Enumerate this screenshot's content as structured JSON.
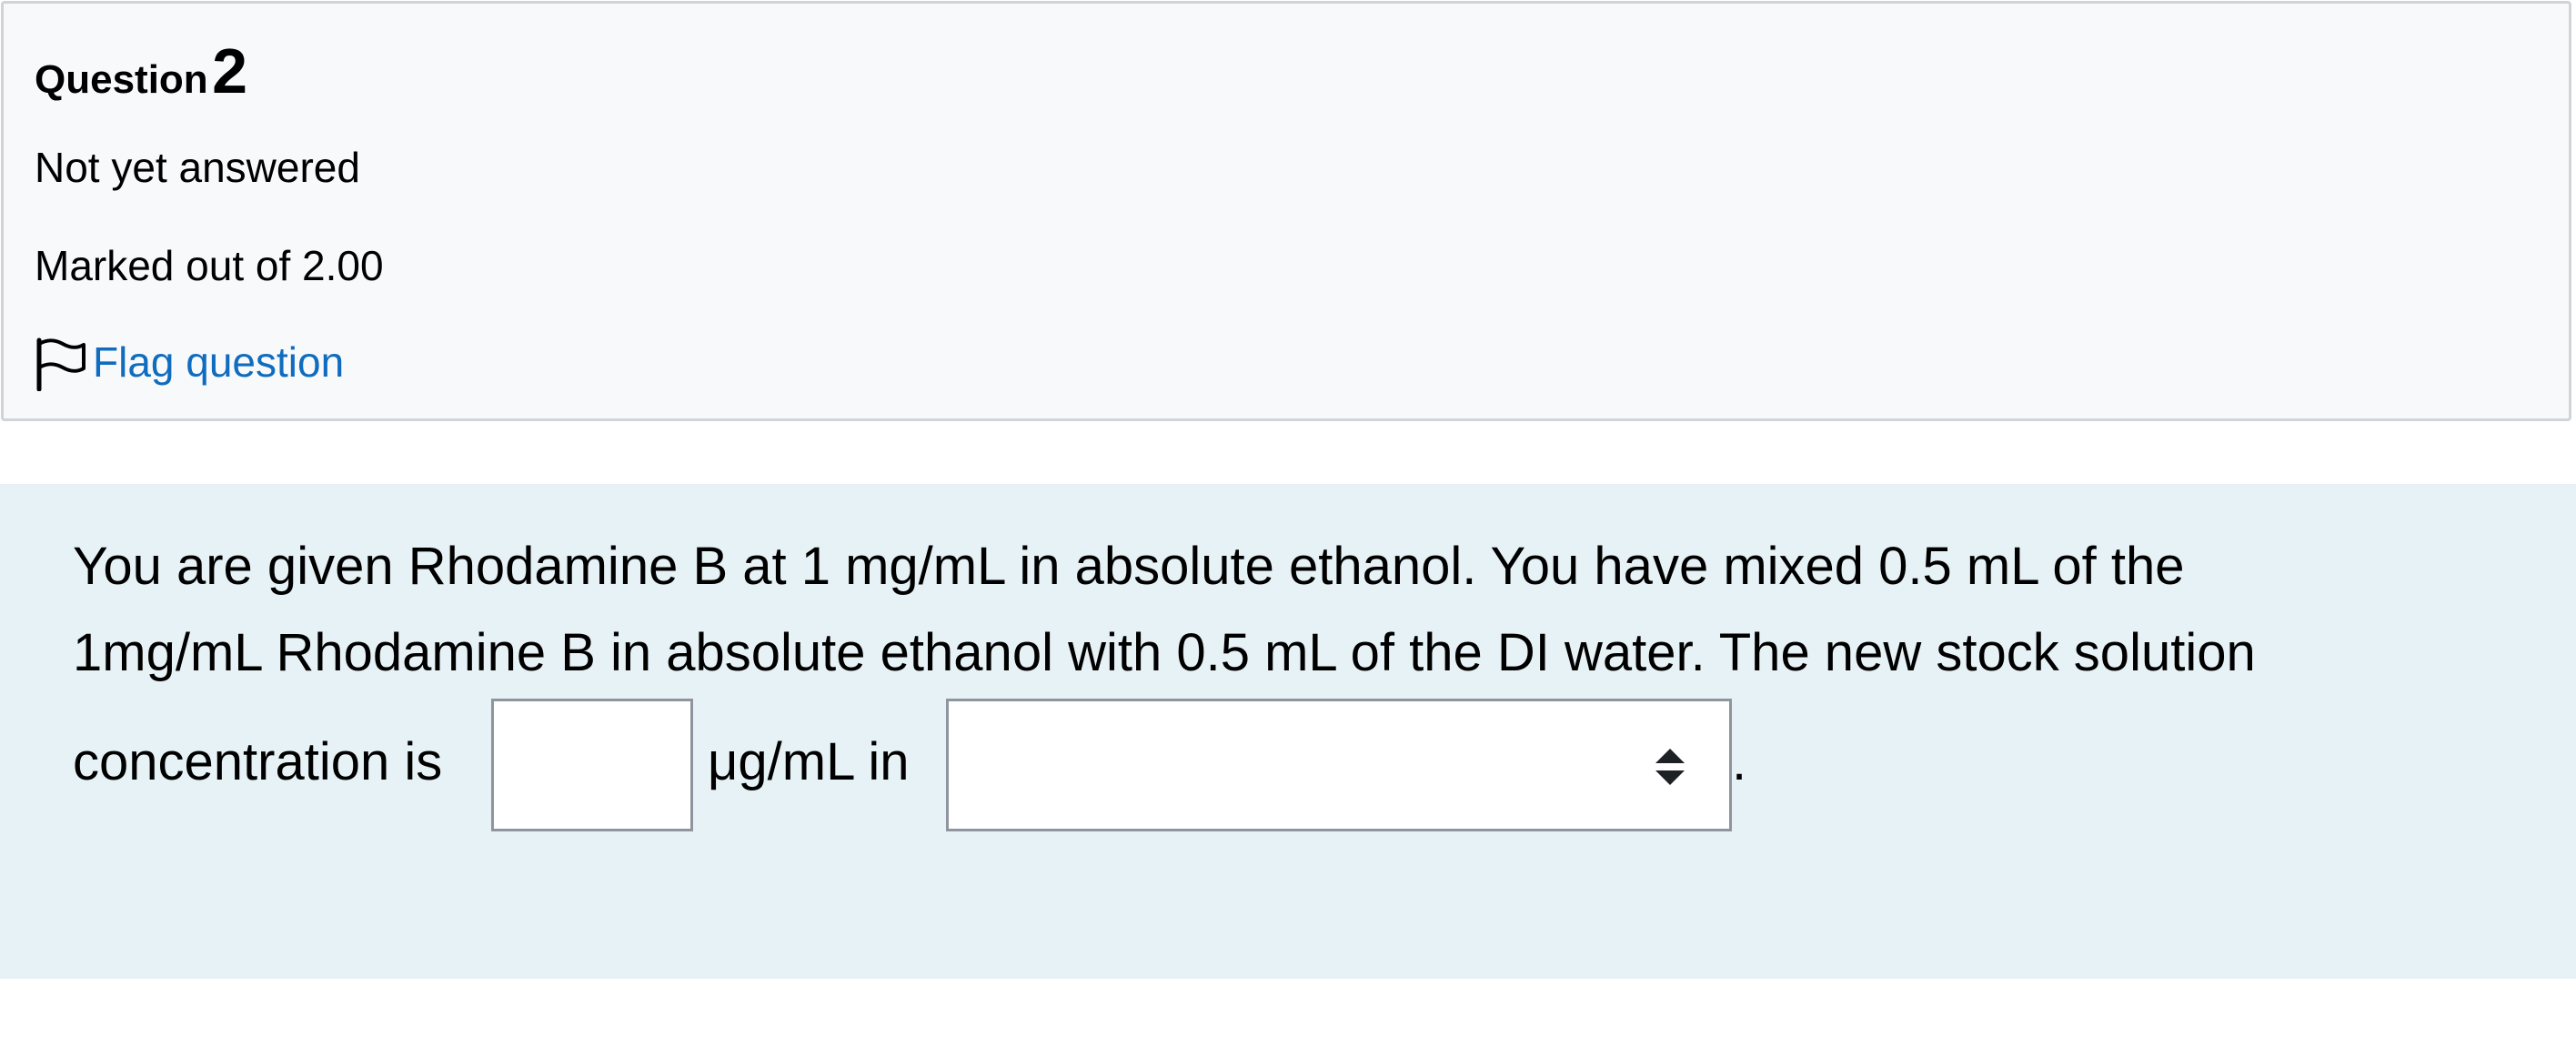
{
  "question_info": {
    "label": "Question",
    "number": "2",
    "state": "Not yet answered",
    "grade": "Marked out of 2.00",
    "flag_label": "Flag question"
  },
  "question": {
    "line1": "You are given Rhodamine B at 1 mg/mL in absolute ethanol. You have mixed 0.5 mL of the",
    "line2": "1mg/mL Rhodamine B in absolute ethanol with 0.5 mL of the DI water. The new stock solution",
    "line3_prefix": "concentration is",
    "unit_text": "μg/mL in",
    "suffix": ".",
    "answer_value": "",
    "select_value": ""
  },
  "icons": {
    "flag": "flag-icon",
    "select_arrows": "select-arrows-icon"
  },
  "colors": {
    "info_background": "#f8f9fa",
    "info_border": "#cfd4da",
    "content_background": "#e7f2f6",
    "link": "#0f6cbf",
    "input_border": "#8f959e"
  }
}
